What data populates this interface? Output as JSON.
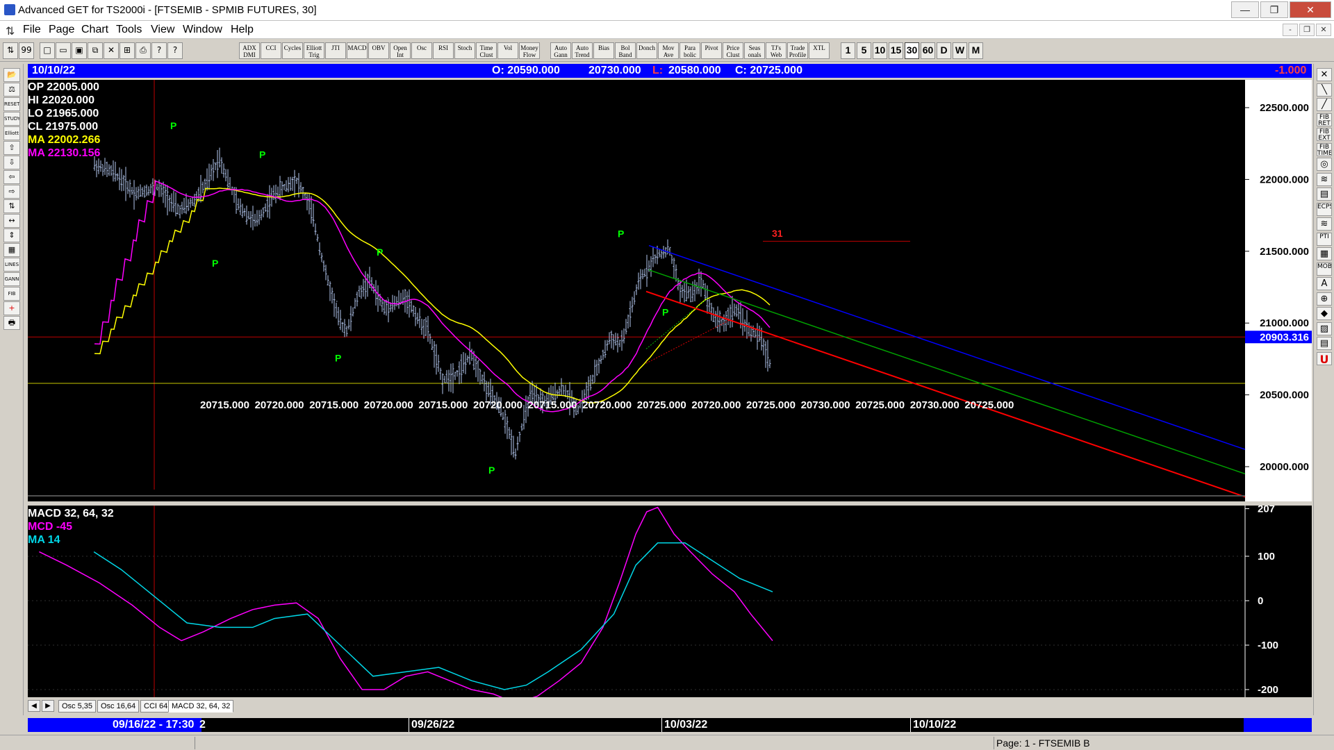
{
  "window": {
    "title": "Advanced GET for TS2000i - [FTSEMIB - SPMIB FUTURES, 30]",
    "minimize": "—",
    "restore": "❐",
    "close": "✕"
  },
  "menu": {
    "items": [
      "File",
      "Page",
      "Chart",
      "Tools",
      "View",
      "Window",
      "Help"
    ],
    "mdi": [
      "-",
      "❐",
      "✕"
    ]
  },
  "toolbar": {
    "file_icons": [
      "⇅",
      "99",
      "□",
      "▭",
      "▣",
      "⧉",
      "✕",
      "⊞",
      "⎙",
      "?",
      "?"
    ],
    "studies": [
      "ADX DMI",
      "CCI",
      "Cycles",
      "Elliott Trig",
      "JTI",
      "MACD",
      "OBV",
      "Open Int",
      "Osc",
      "RSI",
      "Stoch",
      "Time Clust",
      "Vol",
      "Money Flow"
    ],
    "studies2": [
      "Auto Gann",
      "Auto Trend",
      "Bias",
      "Bol Band",
      "Donch",
      "Mov Ave",
      "Para bolic",
      "Pivot",
      "Price Clust",
      "Seas onals",
      "TJ's Web",
      "Trade Profile",
      "XTL"
    ],
    "periods": [
      "1",
      "5",
      "10",
      "15",
      "30",
      "60",
      "D",
      "W",
      "M"
    ],
    "active_period": "30"
  },
  "header": {
    "date": "10/10/22",
    "open": "O: 20590.000",
    "high": "20730.000",
    "low_label": "L:",
    "low": "20580.000",
    "close": "C: 20725.000",
    "change": "-1.000"
  },
  "price_readout": [
    {
      "label": "OP",
      "value": "22005.000",
      "color": "#ffffff"
    },
    {
      "label": "HI",
      "value": "22020.000",
      "color": "#ffffff"
    },
    {
      "label": "LO",
      "value": "21965.000",
      "color": "#ffffff"
    },
    {
      "label": "CL",
      "value": "21975.000",
      "color": "#ffffff"
    },
    {
      "label": "MA",
      "value": "22002.266",
      "color": "#ffff00"
    },
    {
      "label": "MA",
      "value": "22130.156",
      "color": "#ff00ff"
    }
  ],
  "price_axis": {
    "labels": [
      "22500.000",
      "22000.000",
      "21500.000",
      "21000.000",
      "20500.000",
      "20000.000"
    ],
    "current": "20903.316"
  },
  "bottom_axis_labels": [
    "20715.000",
    "20720.000",
    "20715.000",
    "20720.000",
    "20715.000",
    "20720.000",
    "20715.000",
    "20720.000",
    "20725.000",
    "20720.000",
    "20725.000",
    "20730.000",
    "20725.000",
    "20730.000",
    "20725.000"
  ],
  "pivot_label": "P",
  "count_label": "31",
  "macd": {
    "title": "MACD 32, 64, 32",
    "mcd": "MCD -45",
    "ma": "MA   14",
    "axis": [
      "207",
      "100",
      "0",
      "-100",
      "-200"
    ]
  },
  "tabs": [
    "Osc 5,35",
    "Osc 16,64",
    "CCI 64",
    "MACD 32, 64, 32"
  ],
  "tab_nav": [
    "◀",
    "▶"
  ],
  "dates": {
    "cursor": "09/16/22 - 17:30",
    "cursor_suffix": "2",
    "d1": "09/26/22",
    "d2": "10/03/22",
    "d3": "10/10/22"
  },
  "status": {
    "page": "Page: 1 - FTSEMIB B"
  },
  "left_tools": [
    "📂",
    "⚖",
    "RESET",
    "STUDY",
    "Elliott",
    "⇧",
    "⇩",
    "⇦",
    "⇨",
    "⇅",
    "↔",
    "⇕",
    "▦",
    "LINES",
    "GANN",
    "FIB",
    "+",
    "🖶"
  ],
  "right_tools": [
    "✕",
    "╲",
    "╱",
    "FIB RET",
    "FIB EXT",
    "FIB TIME",
    "◎",
    "≋",
    "▤",
    "ECPS",
    "≋",
    "PTI",
    "▦",
    "MOB",
    "A",
    "⊕",
    "◆",
    "▨",
    "▤",
    "U"
  ],
  "colors": {
    "background": "#000000",
    "header": "#0000ff",
    "candles": "#b4c8f0",
    "pivot": "#00ff00",
    "ma_yellow": "#ffff00",
    "ma_magenta": "#ff00ff",
    "macd_line": "#ff00ff",
    "macd_signal": "#00d8e8",
    "trend_blue": "#0000ff",
    "trend_green": "#00a000",
    "trend_red": "#ff0000"
  }
}
